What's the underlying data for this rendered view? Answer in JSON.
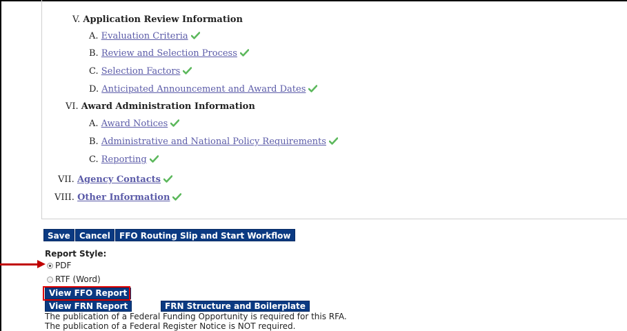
{
  "outline": {
    "section_v": {
      "num": "V.",
      "heading": "Application Review Information"
    },
    "v_a": {
      "letter": "A.",
      "link": "Evaluation Criteria"
    },
    "v_b": {
      "letter": "B.",
      "link": "Review and Selection Process"
    },
    "v_c": {
      "letter": "C.",
      "link": "Selection Factors"
    },
    "v_d": {
      "letter": "D.",
      "link": "Anticipated Announcement and Award Dates"
    },
    "section_vi": {
      "num": "VI.",
      "heading": "Award Administration Information"
    },
    "vi_a": {
      "letter": "A.",
      "link": "Award Notices"
    },
    "vi_b": {
      "letter": "B.",
      "link": "Administrative and National Policy Requirements"
    },
    "vi_c": {
      "letter": "C.",
      "link": "Reporting"
    },
    "section_vii": {
      "num": "VII.",
      "link": "Agency Contacts"
    },
    "section_viii": {
      "num": "VIII.",
      "link": "Other Information"
    }
  },
  "toolbar": {
    "save_label": "Save",
    "cancel_label": "Cancel",
    "routing_label": "FFO Routing Slip and Start Workflow"
  },
  "report_style": {
    "label": "Report Style:",
    "options": [
      "PDF",
      "RTF (Word)"
    ],
    "selected": "PDF"
  },
  "reports": {
    "view_ffo_label": "View FFO Report",
    "view_frn_label": "View FRN Report",
    "frn_structure_label": "FRN Structure and Boilerplate"
  },
  "notes": {
    "line1": "The publication of a Federal Funding Opportunity is required for this RFA.",
    "line2": "The publication of a Federal Register Notice is NOT required."
  },
  "colors": {
    "button_bg": "#0b3a82",
    "link": "#5b5ba8",
    "check": "#5cb85c",
    "highlight": "#e00000"
  },
  "icons": {
    "complete": "check-icon",
    "pointer": "arrow-right-icon"
  }
}
